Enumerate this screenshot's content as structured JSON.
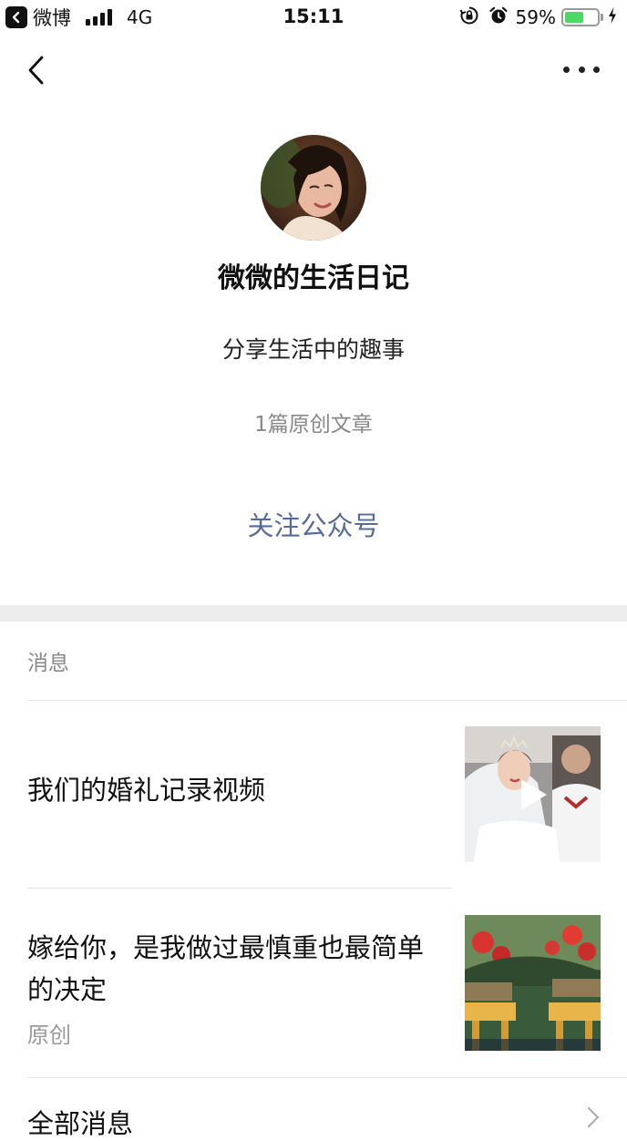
{
  "status_bar": {
    "back_app_label": "微博",
    "network": "4G",
    "time": "15:11",
    "battery_percent": "59%",
    "battery_level": 0.59,
    "icons": [
      "back-to-app-icon",
      "signal-icon",
      "rotation-lock-icon",
      "alarm-icon",
      "battery-icon",
      "charging-icon"
    ]
  },
  "nav": {
    "back_icon": "chevron-left-icon",
    "more_icon": "more-dots-icon"
  },
  "profile": {
    "name": "微微的生活日记",
    "description": "分享生活中的趣事",
    "article_count": "1篇原创文章",
    "follow_label": "关注公众号"
  },
  "messages": {
    "section_title": "消息",
    "items": [
      {
        "title": "我们的婚礼记录视频",
        "tag": "",
        "thumb_icon": "play-icon"
      },
      {
        "title": "嫁给你，是我做过最慎重也最简单的决定",
        "tag": "原创"
      }
    ],
    "all_label": "全部消息"
  },
  "colors": {
    "follow_blue": "#576b95",
    "battery_green": "#4cd964",
    "divider": "#e5e5e5",
    "section_gap": "#ededed"
  }
}
